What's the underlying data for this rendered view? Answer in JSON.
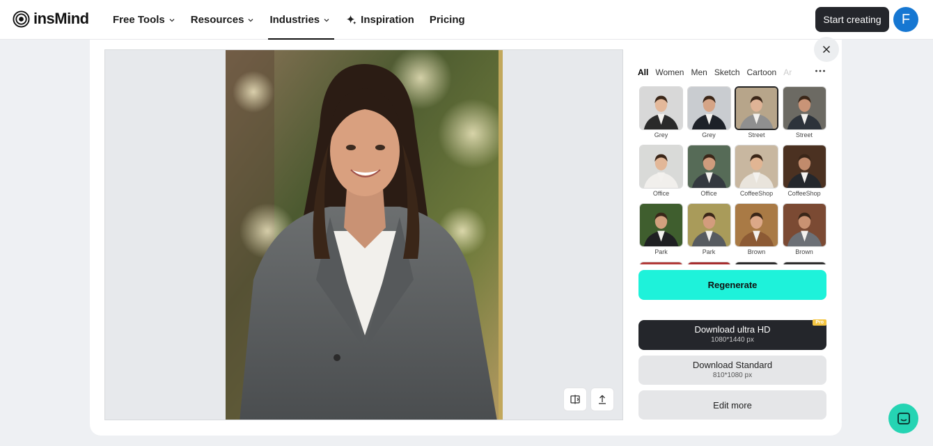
{
  "brand": {
    "name": "insMind"
  },
  "nav": {
    "items": [
      {
        "label": "Free Tools",
        "dropdown": true
      },
      {
        "label": "Resources",
        "dropdown": true
      },
      {
        "label": "Industries",
        "dropdown": true,
        "active": true
      },
      {
        "label": "Inspiration",
        "icon": "sparkle-icon"
      },
      {
        "label": "Pricing"
      }
    ],
    "cta": "Start creating",
    "avatar_initial": "F"
  },
  "categories": [
    "All",
    "Women",
    "Men",
    "Sketch",
    "Cartoon",
    "Ar"
  ],
  "styles": [
    {
      "label": "Grey"
    },
    {
      "label": "Grey"
    },
    {
      "label": "Street",
      "selected": true
    },
    {
      "label": "Street"
    },
    {
      "label": "Office"
    },
    {
      "label": "Office"
    },
    {
      "label": "CoffeeShop"
    },
    {
      "label": "CoffeeShop"
    },
    {
      "label": "Park"
    },
    {
      "label": "Park"
    },
    {
      "label": "Brown"
    },
    {
      "label": "Brown"
    },
    {
      "label": ""
    },
    {
      "label": ""
    },
    {
      "label": ""
    },
    {
      "label": ""
    }
  ],
  "actions": {
    "regenerate": "Regenerate",
    "download_hd": {
      "label": "Download ultra HD",
      "size": "1080*1440 px",
      "badge": "Pro"
    },
    "download_std": {
      "label": "Download Standard",
      "size": "810*1080 px"
    },
    "edit_more": "Edit more"
  },
  "colors": {
    "accent": "#1ef2da",
    "dark": "#24262b",
    "avatar": "#1677d2",
    "chat": "#25d4b3",
    "pro": "#f4c542"
  }
}
